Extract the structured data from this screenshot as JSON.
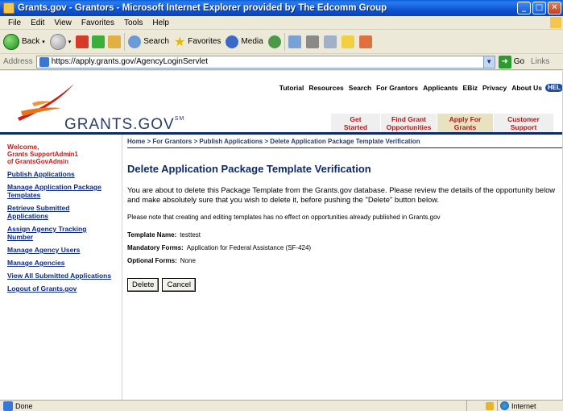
{
  "window": {
    "title": "Grants.gov - Grantors - Microsoft Internet Explorer provided by The Edcomm Group"
  },
  "menu": {
    "items": [
      {
        "label": "File",
        "accel": "F"
      },
      {
        "label": "Edit",
        "accel": "E"
      },
      {
        "label": "View",
        "accel": "V"
      },
      {
        "label": "Favorites",
        "accel": "a"
      },
      {
        "label": "Tools",
        "accel": "T"
      },
      {
        "label": "Help",
        "accel": "H"
      }
    ]
  },
  "toolbar": {
    "back_label": "Back",
    "search_label": "Search",
    "favorites_label": "Favorites",
    "media_label": "Media"
  },
  "address": {
    "label": "Address",
    "url": "https://apply.grants.gov/AgencyLoginServlet",
    "go_label": "Go",
    "links_label": "Links"
  },
  "site": {
    "logo_text": "GRANTS.GOV",
    "logo_mark": "SM",
    "top_nav": [
      "Tutorial",
      "Resources",
      "Search",
      "For Grantors",
      "Applicants",
      "EBiz",
      "Privacy",
      "About Us"
    ],
    "help_label": "HEL",
    "tabs": [
      {
        "line1": "Get",
        "line2": "Started"
      },
      {
        "line1": "Find Grant",
        "line2": "Opportunities"
      },
      {
        "line1": "Apply For",
        "line2": "Grants"
      },
      {
        "line1": "Customer",
        "line2": "Support"
      }
    ]
  },
  "sidebar": {
    "welcome": "Welcome,",
    "user_line1": "Grants SupportAdmin1",
    "user_line2": "of GrantsGovAdmin",
    "links": [
      "Publish Applications",
      "Manage Application Package Templates",
      "Retrieve Submitted Applications",
      "Assign Agency Tracking Number",
      "Manage Agency Users",
      "Manage Agencies",
      "View All Submitted Applications",
      "Logout of Grants.gov"
    ]
  },
  "main": {
    "breadcrumb": "Home > For Grantors > Publish Applications > Delete Application Package Template Verification",
    "title": "Delete Application Package Template Verification",
    "intro": "You are about to delete this Package Template from the Grants.gov database. Please review the details of the opportunity below and make absolutely sure that you wish to delete it, before pushing the \"Delete\" button below.",
    "note": "Please note that creating and editing templates has no effect on opportunities already published in Grants.gov",
    "template_name_label": "Template Name:",
    "template_name_value": "testtest",
    "mandatory_label": "Mandatory Forms:",
    "mandatory_value": "Application for Federal Assistance (SF-424)",
    "optional_label": "Optional Forms:",
    "optional_value": "None",
    "delete_label": "Delete",
    "cancel_label": "Cancel"
  },
  "status": {
    "text": "Done",
    "zone": "Internet"
  }
}
